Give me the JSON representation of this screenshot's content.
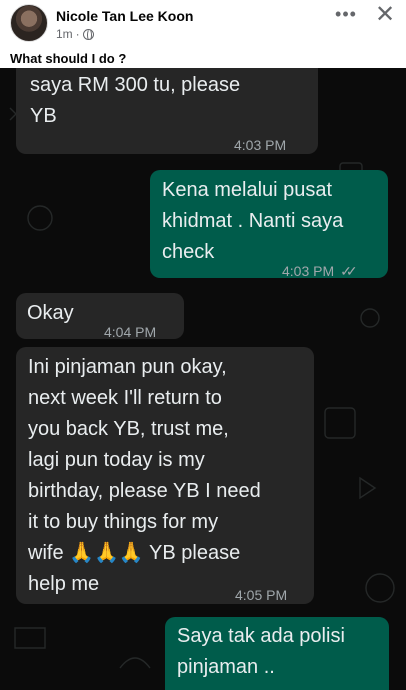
{
  "post": {
    "author": "Nicole Tan Lee Koon",
    "time": "1m",
    "more_icon": "more-horizontal-icon",
    "close_icon": "close-icon",
    "text": "What should I do ?"
  },
  "chat": {
    "messages": [
      {
        "direction": "incoming",
        "text": "saya RM 300 tu, please\nYB",
        "time": "4:03 PM"
      },
      {
        "direction": "outgoing",
        "text": "Kena melalui pusat\nkhidmat . Nanti saya\ncheck",
        "time": "4:03 PM",
        "status": "read"
      },
      {
        "direction": "incoming",
        "text": "Okay",
        "time": "4:04 PM"
      },
      {
        "direction": "incoming",
        "text": "Ini pinjaman pun okay,\nnext week I'll return to\nyou back YB, trust me,\nlagi pun today is my\nbirthday, please YB I need\nit to buy things for my\nwife 🙏🙏🙏 YB please\nhelp me",
        "time": "4:05 PM"
      },
      {
        "direction": "outgoing",
        "text": "Saya tak ada polisi\npinjaman ..",
        "time": ""
      }
    ],
    "colors": {
      "incoming": "#262626",
      "outgoing": "#005c4b",
      "background": "#0b0b0b"
    }
  }
}
